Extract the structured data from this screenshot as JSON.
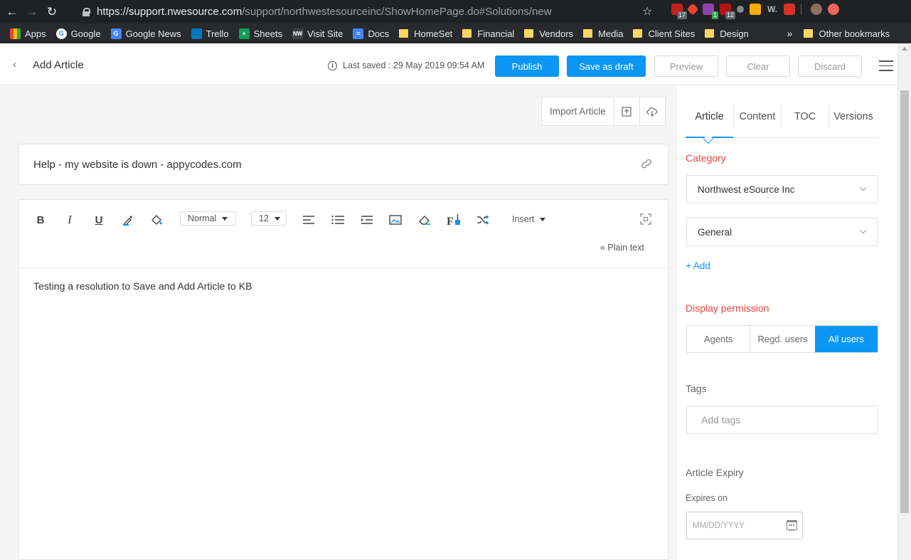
{
  "browser": {
    "url_host": "https://support.nwesource.com",
    "url_path": "/support/northwestesourceinc/ShowHomePage.do#Solutions/new",
    "extension_badges": [
      "17",
      "1",
      "12"
    ],
    "bookmarks": [
      {
        "label": "Apps",
        "icon": "apps-grid-icon",
        "color": "#4285f4"
      },
      {
        "label": "Google",
        "icon": "google-icon",
        "color": "#ffffff"
      },
      {
        "label": "Google News",
        "icon": "google-news-icon",
        "color": "#4285f4"
      },
      {
        "label": "Trello",
        "icon": "trello-icon",
        "color": "#0079bf"
      },
      {
        "label": "Sheets",
        "icon": "sheets-icon",
        "color": "#0f9d58"
      },
      {
        "label": "Visit Site",
        "icon": "nw-icon",
        "color": "#3c4043"
      },
      {
        "label": "Docs",
        "icon": "docs-icon",
        "color": "#4285f4"
      },
      {
        "label": "HomeSet",
        "icon": "folder-icon"
      },
      {
        "label": "Financial",
        "icon": "folder-icon"
      },
      {
        "label": "Vendors",
        "icon": "folder-icon"
      },
      {
        "label": "Media",
        "icon": "folder-icon"
      },
      {
        "label": "Client Sites",
        "icon": "folder-icon"
      },
      {
        "label": "Design",
        "icon": "folder-icon"
      }
    ],
    "bookmarks_more": "»",
    "other_bookmarks": "Other bookmarks"
  },
  "header": {
    "back_glyph": "‹",
    "title": "Add Article",
    "last_saved": "Last saved : 29 May 2019 09:54 AM",
    "buttons": {
      "publish": "Publish",
      "save_draft": "Save as draft",
      "preview": "Preview",
      "clear": "Clear",
      "discard": "Discard"
    }
  },
  "main": {
    "import_label": "Import Article",
    "article_title": "Help - my website is down - appycodes.com",
    "toolbar": {
      "bold": "B",
      "italic": "I",
      "underline": "U",
      "font_format": "Normal",
      "font_size": "12",
      "insert": "Insert",
      "plain_text": "« Plain text"
    },
    "content": "Testing a resolution to Save and Add Article to KB"
  },
  "side": {
    "tabs": [
      "Article",
      "Content",
      "TOC",
      "Versions"
    ],
    "active_tab": "Article",
    "category_label": "Category",
    "category_value": "Northwest eSource Inc",
    "folder_value": "General",
    "add_label": "+ Add",
    "permission_label": "Display permission",
    "permissions": [
      "Agents",
      "Regd. users",
      "All users"
    ],
    "active_permission": "All users",
    "tags_label": "Tags",
    "tags_placeholder": "Add tags",
    "expiry_label": "Article Expiry",
    "expires_on_label": "Expires on",
    "date_placeholder": "MM/DD/YYYY"
  },
  "colors": {
    "accent": "#0b96f4",
    "required_label": "#e8453c"
  }
}
